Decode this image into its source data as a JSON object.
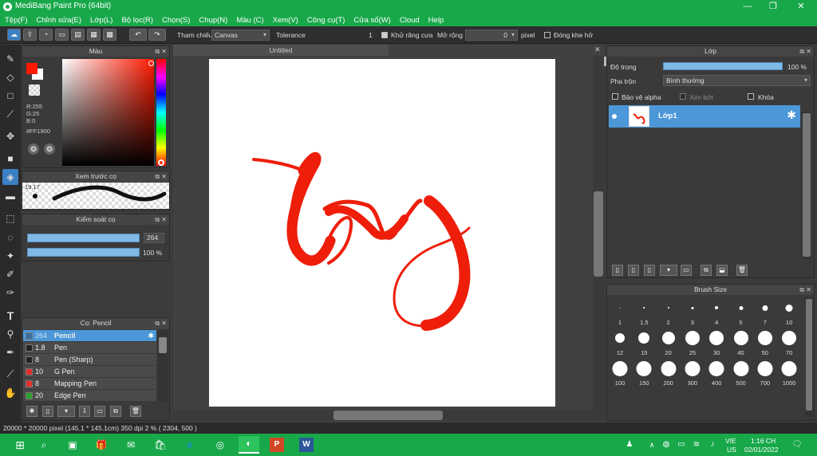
{
  "window": {
    "title": "MediBang Paint Pro (64bit)",
    "minimize": "—",
    "maximize": "❐",
    "close": "✕"
  },
  "menu": [
    "Tệp(F)",
    "Chỉnh sửa(E)",
    "Lớp(L)",
    "Bộ lọc(R)",
    "Chọn(S)",
    "Chụp(N)",
    "Màu (C)",
    "Xem(V)",
    "Công cụ(T)",
    "Cửa sổ(W)",
    "Cloud",
    "Help"
  ],
  "toolbar": {
    "reference_label": "Tham chiếu",
    "reference_value": "Canvas",
    "tolerance_label": "Tolerance",
    "tolerance_value": "1",
    "antialias_label": "Khử răng cưa",
    "expand_label": "Mở rộng",
    "expand_value": "0",
    "expand_unit": "pixel",
    "close_gap_label": "Đóng khe hở"
  },
  "color_panel": {
    "title": "Màu",
    "r": "R:255",
    "g": "G:25",
    "b": "B:0",
    "hex": "#FF1900",
    "fg_color": "#ff1900",
    "bg_color": "#ffffff"
  },
  "brush_preview": {
    "title": "Xem trước cọ",
    "size_text": "19.17"
  },
  "brush_control": {
    "title": "Kiểm soát cọ",
    "size_value": "264",
    "opacity_value": "100 %"
  },
  "brush_list": {
    "title": "Cọ: Pencil",
    "items": [
      {
        "size": "264",
        "name": "Pencil",
        "color": "#3a6fa0"
      },
      {
        "size": "1.8",
        "name": "Pen",
        "color": "#222222"
      },
      {
        "size": "8",
        "name": "Pen (Sharp)",
        "color": "#222222"
      },
      {
        "size": "10",
        "name": "G Pen",
        "color": "#e03030"
      },
      {
        "size": "8",
        "name": "Mapping Pen",
        "color": "#e03030"
      },
      {
        "size": "20",
        "name": "Edge Pen",
        "color": "#30a030"
      }
    ]
  },
  "canvas": {
    "tab": "Untitled"
  },
  "layer_panel": {
    "title": "Lớp",
    "opacity_label": "Độ trong",
    "opacity_value": "100 %",
    "blend_label": "Pha trộn",
    "blend_value": "Bình thường",
    "protect_alpha": "Bảo vệ alpha",
    "clipping": "Xén bớt",
    "lock": "Khóa",
    "layers": [
      {
        "name": "Lớp1"
      }
    ]
  },
  "brush_size_panel": {
    "title": "Brush Size",
    "sizes": [
      "1",
      "1.5",
      "2",
      "3",
      "4",
      "5",
      "7",
      "10",
      "12",
      "15",
      "20",
      "25",
      "30",
      "40",
      "50",
      "70",
      "100",
      "150",
      "200",
      "300",
      "400",
      "500",
      "700",
      "1000"
    ]
  },
  "status": {
    "text": "20000 * 20000 pixel   (145.1 * 145.1cm)   350 dpi   2 %   ( 2304, 500 )"
  },
  "taskbar": {
    "lang_top": "VIE",
    "lang_bottom": "US",
    "time": "1:16 CH",
    "date": "02/01/2022"
  }
}
